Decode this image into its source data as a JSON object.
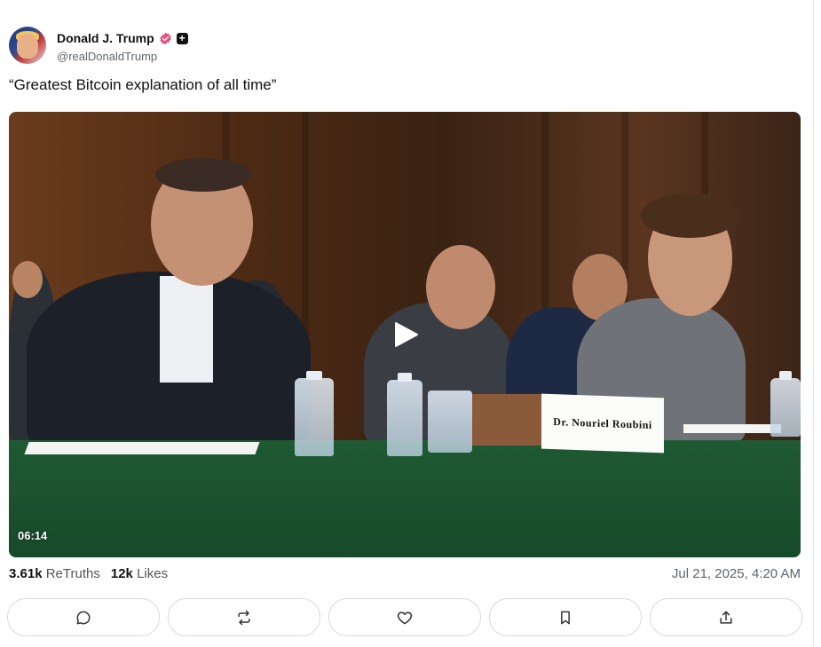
{
  "post": {
    "author_name": "Donald J. Trump",
    "author_handle": "@realDonaldTrump",
    "text": "“Greatest Bitcoin explanation of all time”",
    "video": {
      "duration": "06:14",
      "nameplate": "Dr. Nouriel Roubini"
    },
    "stats": {
      "retruths_count": "3.61k",
      "retruths_label": "ReTruths",
      "likes_count": "12k",
      "likes_label": "Likes"
    },
    "timestamp": "Jul 21, 2025, 4:20 AM"
  },
  "icons": {
    "verified": "verified-badge-icon",
    "pro": "plus-badge-icon",
    "play": "play-icon",
    "reply": "comment-icon",
    "retruth": "repost-icon",
    "like": "heart-icon",
    "bookmark": "bookmark-icon",
    "share": "share-icon"
  },
  "colors": {
    "verified_badge": "#ea4e7a",
    "table_green": "#1d5632",
    "border": "#d8dade"
  }
}
